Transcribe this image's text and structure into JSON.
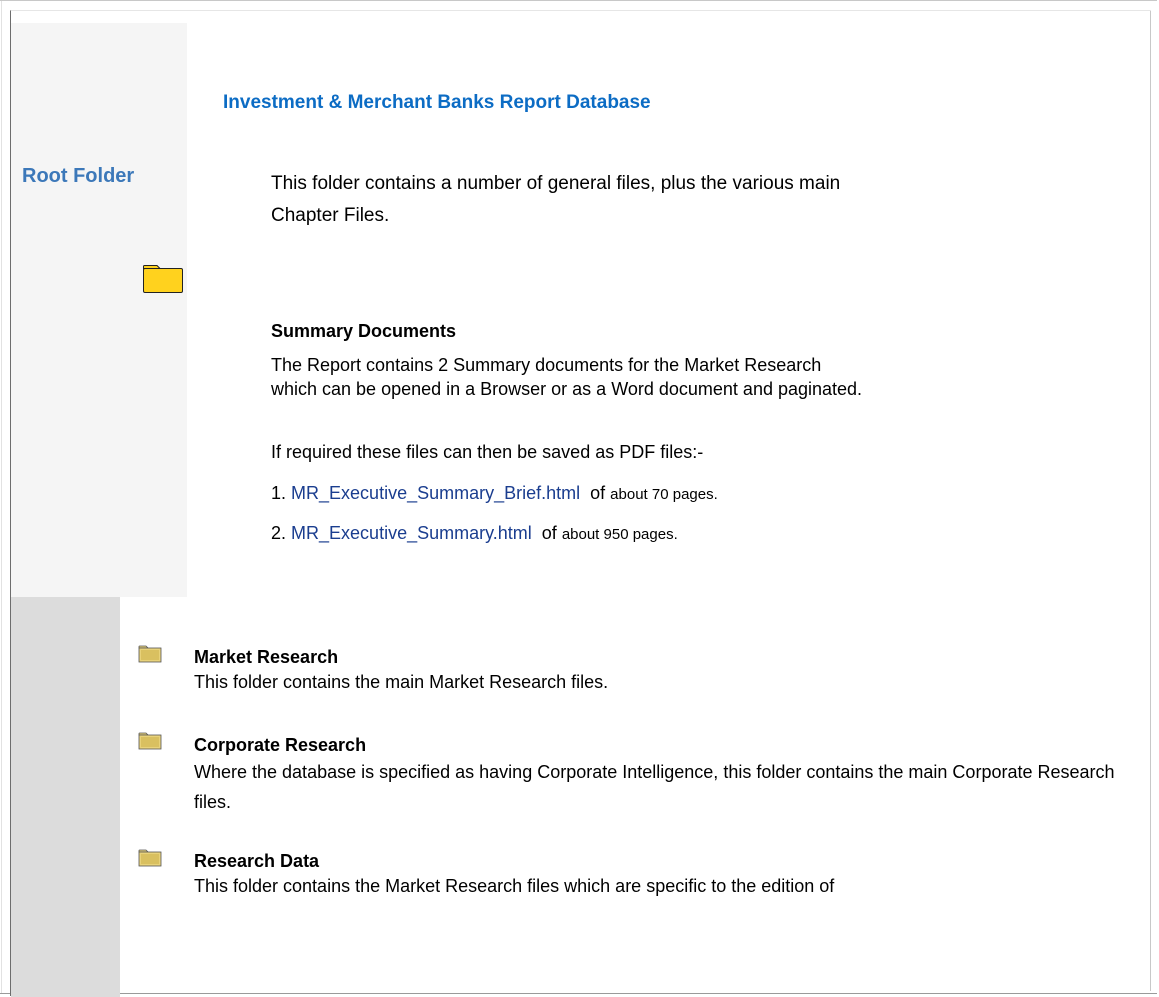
{
  "sidebar": {
    "root_label": "Root Folder",
    "root_icon": "folder-icon"
  },
  "header": {
    "title": "Investment & Merchant Banks Report Database"
  },
  "intro": {
    "text": "This folder contains a number of general files, plus the various main Chapter Files."
  },
  "summary": {
    "heading": "Summary Documents",
    "body": "The Report contains 2 Summary documents for the Market Research which can be opened in a Browser or as a Word document and paginated.",
    "pdf_note": "If required these files can then be saved as PDF files:-",
    "documents": [
      {
        "number": "1.",
        "link": "MR_Executive_Summary_Brief.html",
        "of": "of",
        "pages": "about 70 pages."
      },
      {
        "number": "2.",
        "link": "MR_Executive_Summary.html",
        "of": "of",
        "pages": "about 950 pages."
      }
    ]
  },
  "folders": [
    {
      "icon": "folder-icon",
      "name": "Market Research",
      "description": "This folder contains the main Market Research files."
    },
    {
      "icon": "folder-icon",
      "name": "Corporate Research",
      "description": "Where the database is specified as having Corporate Intelligence, this folder contains the main Corporate Research files."
    },
    {
      "icon": "folder-icon",
      "name": "Research Data",
      "description": "This folder contains the Market Research files which are specific to the edition of"
    }
  ],
  "colors": {
    "title": "#0c6cc4",
    "root_label": "#3c78b9",
    "link": "#1a3d8f",
    "folder_yellow": "#ffd21e",
    "side_panel": "#f5f5f5",
    "bottom_left": "#dcdcdc"
  }
}
